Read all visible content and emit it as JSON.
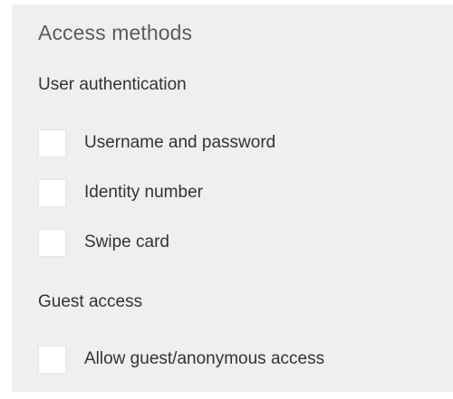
{
  "panel": {
    "title": "Access methods"
  },
  "user_authentication": {
    "heading": "User authentication",
    "options": [
      {
        "label": "Username and password",
        "checked": false
      },
      {
        "label": "Identity number",
        "checked": false
      },
      {
        "label": "Swipe card",
        "checked": false
      }
    ]
  },
  "guest_access": {
    "heading": "Guest access",
    "options": [
      {
        "label": "Allow guest/anonymous access",
        "checked": false
      }
    ]
  },
  "colors": {
    "panel_background": "#efefef",
    "checkbox_background": "#ffffff",
    "title_text": "#5c5c5c",
    "body_text": "#333333"
  }
}
